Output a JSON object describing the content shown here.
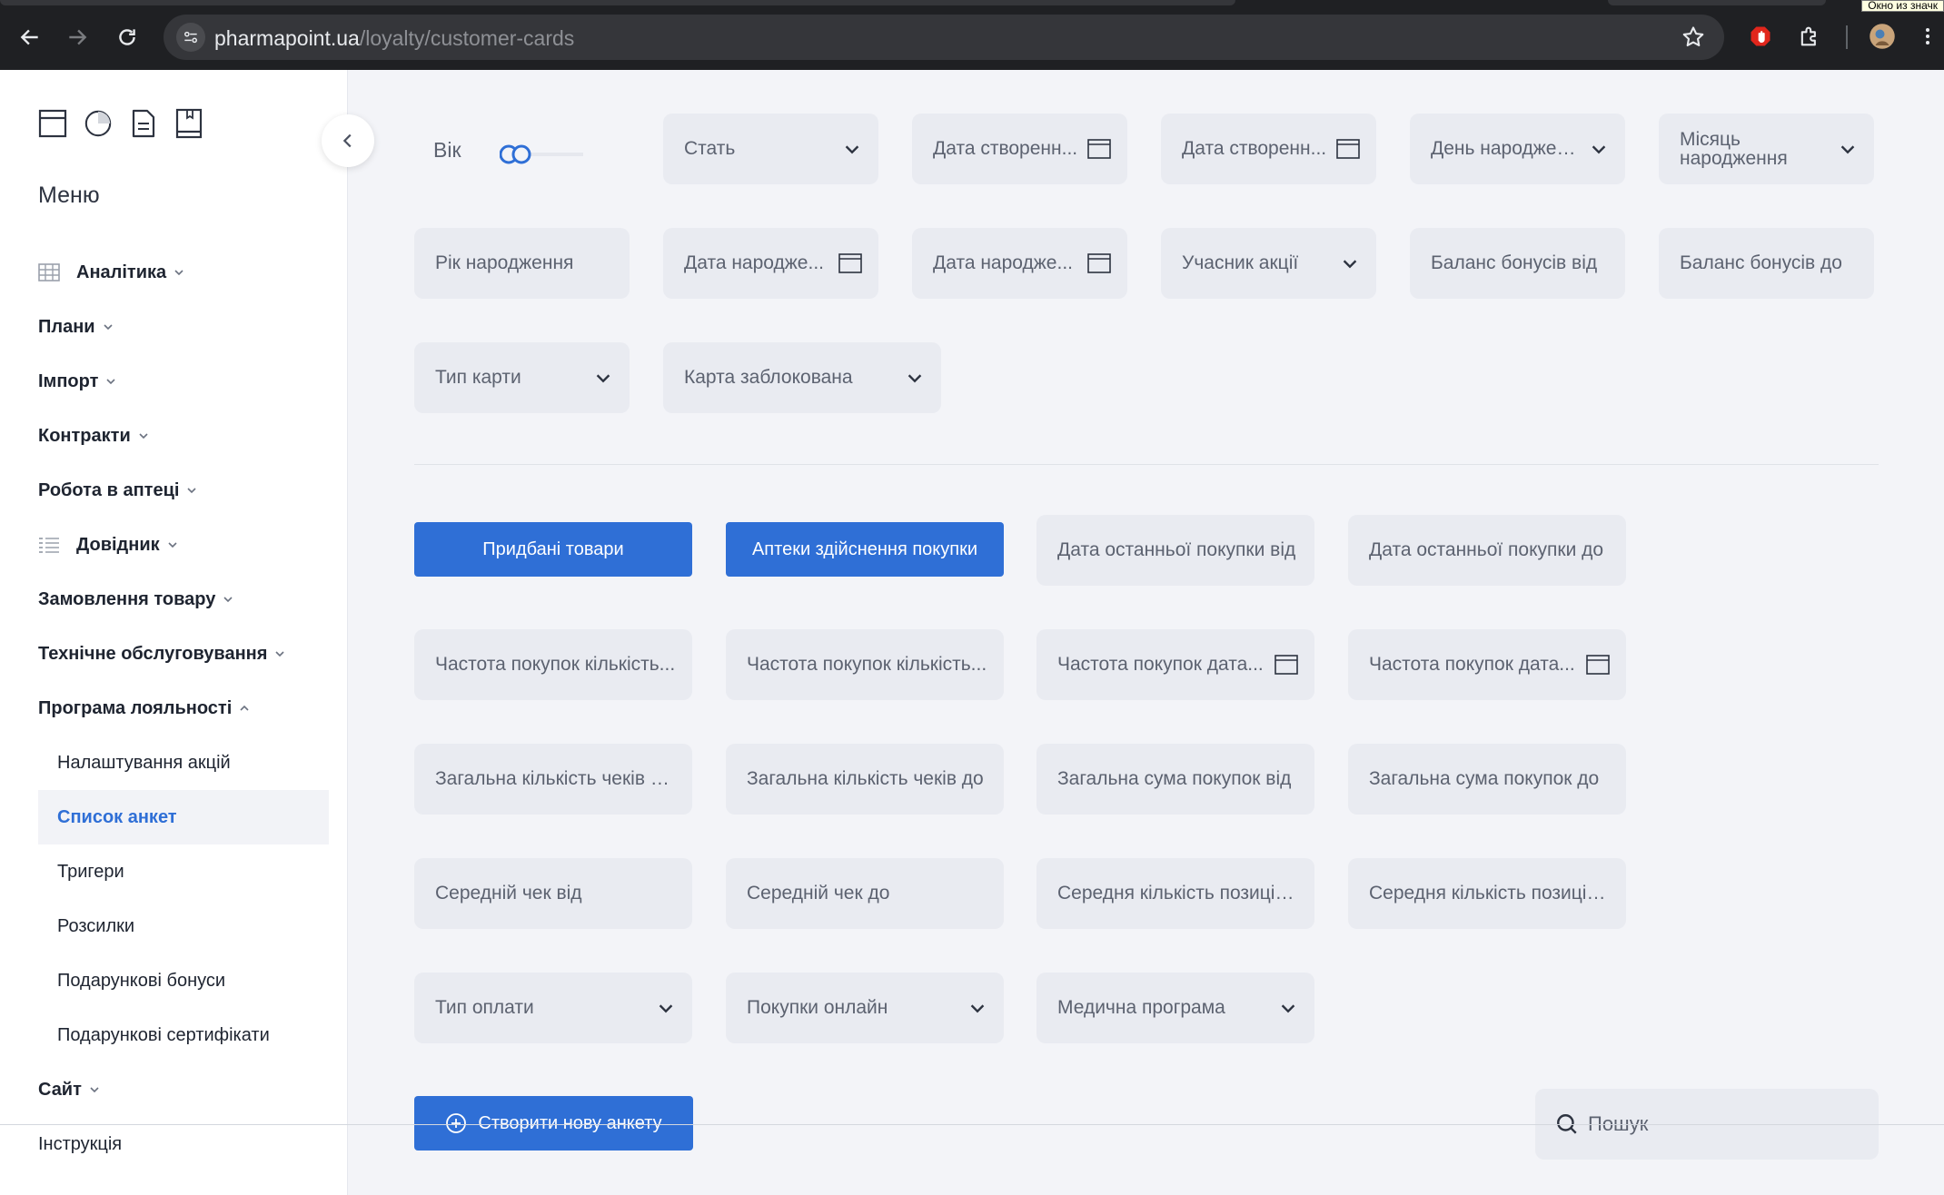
{
  "browser": {
    "url_host": "pharmapoint.ua",
    "url_path": "/loyalty/customer-cards",
    "tooltip": "Окно из значк"
  },
  "sidebar": {
    "menu_title": "Меню",
    "items": [
      {
        "label": "Аналітика",
        "icon": "table-icon"
      },
      {
        "label": "Плани"
      },
      {
        "label": "Імпорт"
      },
      {
        "label": "Контракти"
      },
      {
        "label": "Робота в аптеці"
      },
      {
        "label": "Довідник",
        "icon": "list-icon"
      },
      {
        "label": "Замовлення товару"
      },
      {
        "label": "Технічне обслуговування"
      },
      {
        "label": "Програма лояльності",
        "expanded": true
      }
    ],
    "subitems": [
      {
        "label": "Налаштування акцій"
      },
      {
        "label": "Список анкет",
        "active": true
      },
      {
        "label": "Тригери"
      },
      {
        "label": "Розсилки"
      },
      {
        "label": "Подарункові бонуси"
      },
      {
        "label": "Подарункові сертифікати"
      }
    ],
    "bottom_items": [
      {
        "label": "Сайт"
      },
      {
        "label": "Інструкція"
      }
    ]
  },
  "filters": {
    "age_label": "Вік",
    "row1": [
      "Стать",
      "Дата створенн...",
      "Дата створенн...",
      "День народження",
      "Місяць народження"
    ],
    "row2": [
      "Рік народження",
      "Дата народже...",
      "Дата народже...",
      "Учасник акції",
      "Баланс бонусів від",
      "Баланс бонусів до"
    ],
    "row3": [
      "Тип карти",
      "Карта заблокована"
    ]
  },
  "purchase_filters": {
    "buttons": [
      "Придбані товари",
      "Аптеки здійснення покупки"
    ],
    "row1": [
      "Дата останньої покупки від",
      "Дата останньої покупки до"
    ],
    "row2": [
      "Частота покупок кількість...",
      "Частота покупок кількість...",
      "Частота покупок дата...",
      "Частота покупок дата..."
    ],
    "row3": [
      "Загальна кількість чеків в...",
      "Загальна кількість чеків до",
      "Загальна сума покупок від",
      "Загальна сума покупок до"
    ],
    "row4": [
      "Середній чек від",
      "Середній чек до",
      "Середня кількість позицій...",
      "Середня кількість позицій..."
    ],
    "row5": [
      "Тип оплати",
      "Покупки онлайн",
      "Медична програма"
    ]
  },
  "actions": {
    "create_label": "Створити нову анкету",
    "search_placeholder": "Пошук"
  },
  "colors": {
    "accent": "#2f6fd6",
    "field_bg": "#e9ebf1",
    "page_bg": "#f3f4f8"
  }
}
